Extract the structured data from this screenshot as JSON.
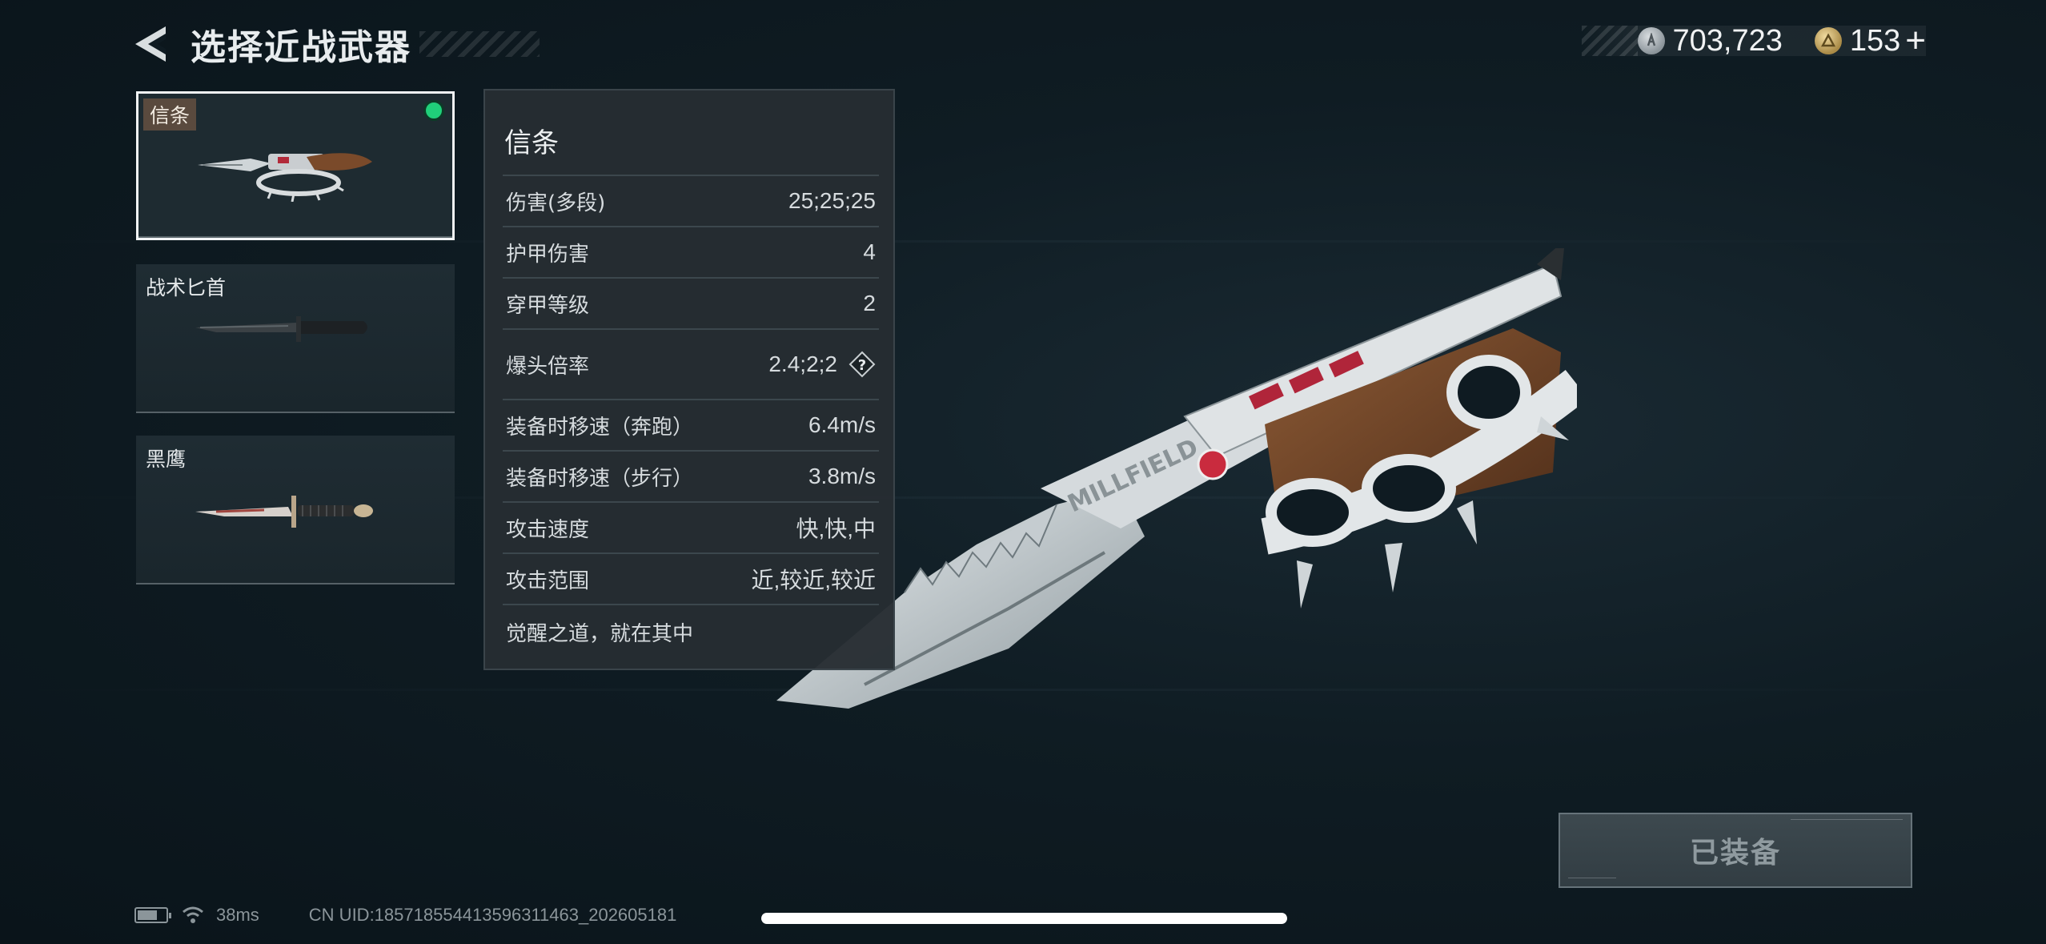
{
  "header": {
    "title": "选择近战武器"
  },
  "currency": {
    "silver": "703,723",
    "gold": "153",
    "plus": "+"
  },
  "weapons": [
    {
      "name": "信条",
      "selected": true,
      "equipped": true
    },
    {
      "name": "战术匕首",
      "selected": false,
      "equipped": false
    },
    {
      "name": "黑鹰",
      "selected": false,
      "equipped": false
    }
  ],
  "stats": {
    "title": "信条",
    "rows": [
      {
        "label": "伤害(多段)",
        "value": "25;25;25"
      },
      {
        "label": "护甲伤害",
        "value": "4"
      },
      {
        "label": "穿甲等级",
        "value": "2"
      },
      {
        "label": "爆头倍率",
        "value": "2.4;2;2"
      },
      {
        "label": "装备时移速（奔跑）",
        "value": "6.4m/s"
      },
      {
        "label": "装备时移速（步行）",
        "value": "3.8m/s"
      },
      {
        "label": "攻击速度",
        "value": "快,快,中"
      },
      {
        "label": "攻击范围",
        "value": "近,较近,较近"
      }
    ],
    "description": "觉醒之道，就在其中"
  },
  "equip_button": {
    "label": "已装备"
  },
  "status_bar": {
    "ping": "38ms",
    "uid": "CN UID:18571855441359631146​3_202605181"
  },
  "colors": {
    "equipped_dot": "#20d07a",
    "selected_border": "#f2f4f5",
    "panel_bg": "#262d32",
    "name_tag_bg": "#5a4a3e"
  },
  "icons": {
    "back": "back-arrow-icon",
    "silver_coin": "silver-coin-icon",
    "gold_coin": "gold-coin-icon",
    "help": "question-mark-icon",
    "battery": "battery-icon",
    "wifi": "wifi-icon"
  }
}
